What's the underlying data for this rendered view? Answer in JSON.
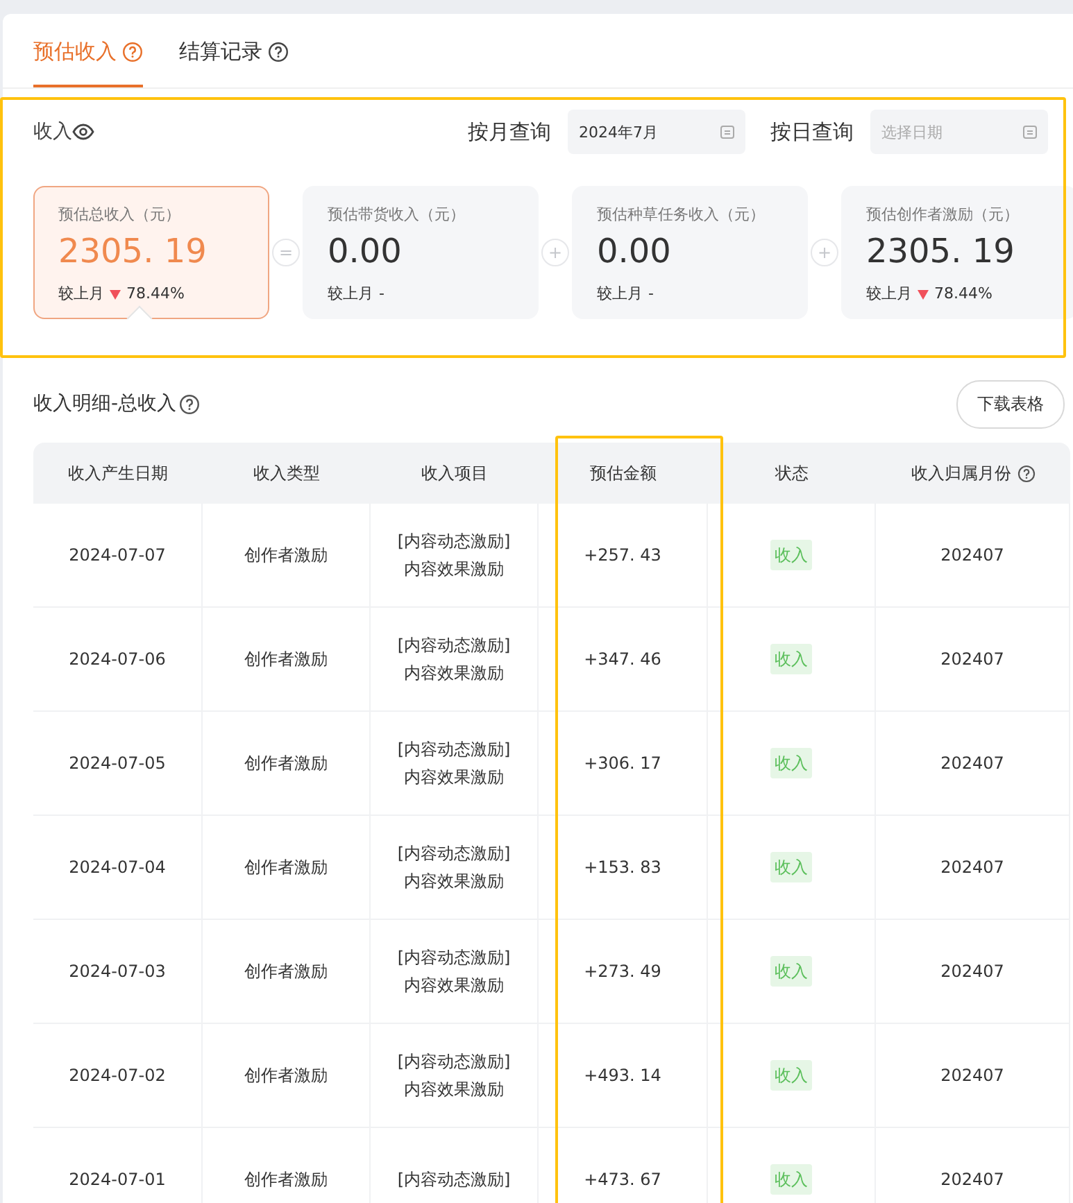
{
  "tabs": [
    {
      "label": "预估收入",
      "selected": true,
      "help": true
    },
    {
      "label": "结算记录",
      "selected": false,
      "help": true
    }
  ],
  "summary": {
    "title": "收入",
    "month_query": {
      "label": "按月查询",
      "value": "2024年7月"
    },
    "day_query": {
      "label": "按日查询",
      "placeholder": "选择日期"
    },
    "cards": [
      {
        "label": "预估总收入（元）",
        "value": "2305. 19",
        "compare_label": "较上月",
        "change": "78.44%",
        "decline": true,
        "selected": true
      },
      {
        "operator": "=",
        "label": "预估带货收入（元）",
        "value": "0.00",
        "compare_label": "较上月",
        "change": "-",
        "decline": false,
        "selected": false
      },
      {
        "operator": "+",
        "label": "预估种草任务收入（元）",
        "value": "0.00",
        "compare_label": "较上月",
        "change": "-",
        "decline": false,
        "selected": false
      },
      {
        "operator": "+",
        "label": "预估创作者激励（元）",
        "value": "2305. 19",
        "compare_label": "较上月",
        "change": "78.44%",
        "decline": true,
        "selected": false
      }
    ]
  },
  "detail": {
    "title": "收入明细-总收入",
    "download_button": "下载表格",
    "columns": [
      {
        "label": "收入产生日期",
        "help": false
      },
      {
        "label": "收入类型",
        "help": false
      },
      {
        "label": "收入项目",
        "help": false
      },
      {
        "label": "预估金额",
        "help": false
      },
      {
        "label": "状态",
        "help": false
      },
      {
        "label": "收入归属月份",
        "help": true
      }
    ],
    "rows": [
      {
        "date": "2024-07-07",
        "type": "创作者激励",
        "items": [
          "[内容动态激励]",
          "内容效果激励"
        ],
        "amount": "+257. 43",
        "status": "收入",
        "month": "202407"
      },
      {
        "date": "2024-07-06",
        "type": "创作者激励",
        "items": [
          "[内容动态激励]",
          "内容效果激励"
        ],
        "amount": "+347. 46",
        "status": "收入",
        "month": "202407"
      },
      {
        "date": "2024-07-05",
        "type": "创作者激励",
        "items": [
          "[内容动态激励]",
          "内容效果激励"
        ],
        "amount": "+306. 17",
        "status": "收入",
        "month": "202407"
      },
      {
        "date": "2024-07-04",
        "type": "创作者激励",
        "items": [
          "[内容动态激励]",
          "内容效果激励"
        ],
        "amount": "+153. 83",
        "status": "收入",
        "month": "202407"
      },
      {
        "date": "2024-07-03",
        "type": "创作者激励",
        "items": [
          "[内容动态激励]",
          "内容效果激励"
        ],
        "amount": "+273. 49",
        "status": "收入",
        "month": "202407"
      },
      {
        "date": "2024-07-02",
        "type": "创作者激励",
        "items": [
          "[内容动态激励]",
          "内容效果激励"
        ],
        "amount": "+493. 14",
        "status": "收入",
        "month": "202407"
      },
      {
        "date": "2024-07-01",
        "type": "创作者激励",
        "items": [
          "[内容动态激励]"
        ],
        "amount": "+473. 67",
        "status": "收入",
        "month": "202407"
      }
    ]
  }
}
